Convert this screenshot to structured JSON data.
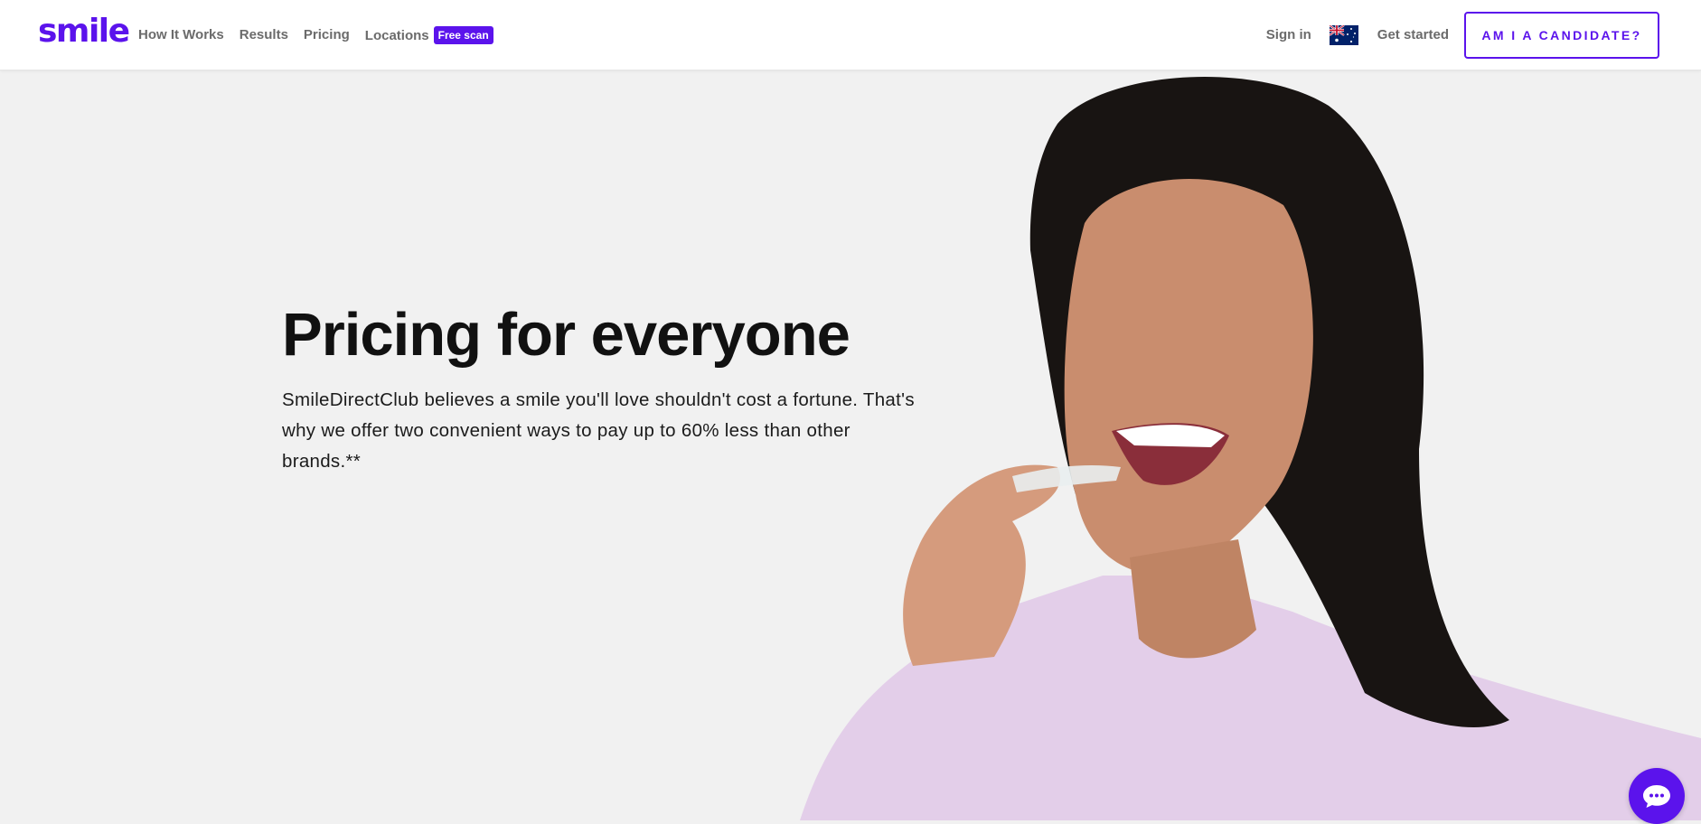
{
  "header": {
    "logo": "smile",
    "nav": [
      {
        "label": "How It Works"
      },
      {
        "label": "Results"
      },
      {
        "label": "Pricing"
      },
      {
        "label": "Locations",
        "badge": "Free scan"
      }
    ],
    "sign_in": "Sign in",
    "country_flag": "australia-flag-icon",
    "get_started": "Get started",
    "cta": "AM I A CANDIDATE?"
  },
  "hero": {
    "title": "Pricing for everyone",
    "body": "SmileDirectClub believes a smile you'll love shouldn't cost a fortune. That's why we offer two convenient ways to pay up to 60% less than other brands.**",
    "image": "woman-holding-clear-aligner-photo"
  },
  "chat": {
    "icon": "chat-bubble-icon"
  },
  "colors": {
    "brand": "#5b13ec",
    "background": "#f1f1f1",
    "header_bg": "#ffffff",
    "nav_text": "#6b6b6b",
    "heading": "#111111"
  }
}
